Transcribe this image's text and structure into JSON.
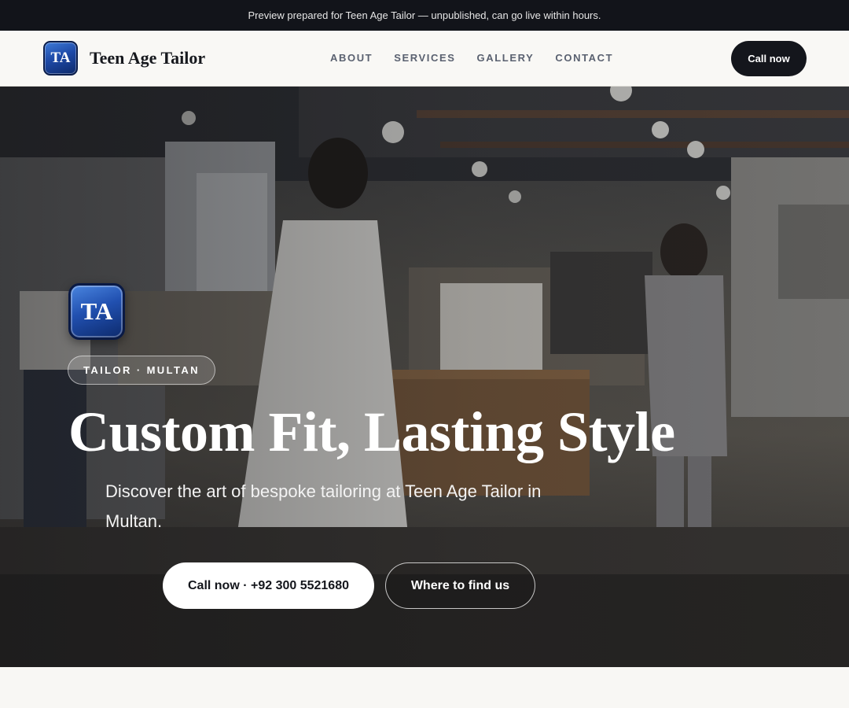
{
  "topbar": {
    "text": "Preview prepared for Teen Age Tailor — unpublished, can go live within hours."
  },
  "nav": {
    "logo_text": "TA",
    "brand_name": "Teen Age Tailor",
    "menu": [
      "ABOUT",
      "SERVICES",
      "GALLERY",
      "CONTACT"
    ],
    "cta_label": "Call now"
  },
  "hero": {
    "image_icon": "boutique-photo",
    "logo_text": "TA",
    "tag": "TAILOR · MULTAN",
    "headline": "Custom Fit, Lasting Style",
    "subheadline": "Discover the art of bespoke tailoring at Teen Age Tailor in Multan.",
    "primary_button": "Call now · +92 300 5521680",
    "secondary_button": "Where to find us"
  },
  "colors": {
    "topbar_bg": "#12141a",
    "accent_dark": "#14161c",
    "logo_blue": "#1e4aa8",
    "page_bg": "#f8f7f4"
  }
}
